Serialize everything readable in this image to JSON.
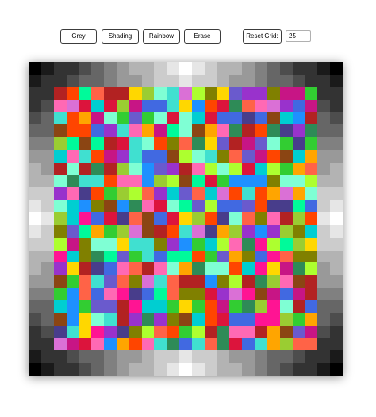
{
  "toolbar": {
    "buttons": [
      {
        "id": "grey",
        "label": "Grey"
      },
      {
        "id": "shading",
        "label": "Shading"
      },
      {
        "id": "rainbow",
        "label": "Rainbow"
      },
      {
        "id": "erase",
        "label": "Erase"
      }
    ],
    "reset_label": "Reset Grid:",
    "grid_size_value": "25"
  },
  "grid": {
    "size": 25,
    "palette": [
      "#8b4513",
      "#ff1493",
      "#32cd32",
      "#1e90ff",
      "#ffd700",
      "#9932cc",
      "#00ced1",
      "#ff4500",
      "#adff2f",
      "#dc143c",
      "#4169e1",
      "#ff69b4",
      "#2e8b57",
      "#ffa500",
      "#6a5acd",
      "#00fa9a",
      "#b22222",
      "#7fffd4",
      "#da70d6",
      "#808000",
      "#40e0d0",
      "#c71585",
      "#9acd32",
      "#483d8b",
      "#ff6347"
    ],
    "border_shades": [
      "#000000",
      "#1a1a1a",
      "#333333",
      "#4d4d4d",
      "#666666",
      "#808080",
      "#999999",
      "#b3b3b3",
      "#cccccc",
      "#e6e6e6",
      "#ffffff"
    ]
  }
}
